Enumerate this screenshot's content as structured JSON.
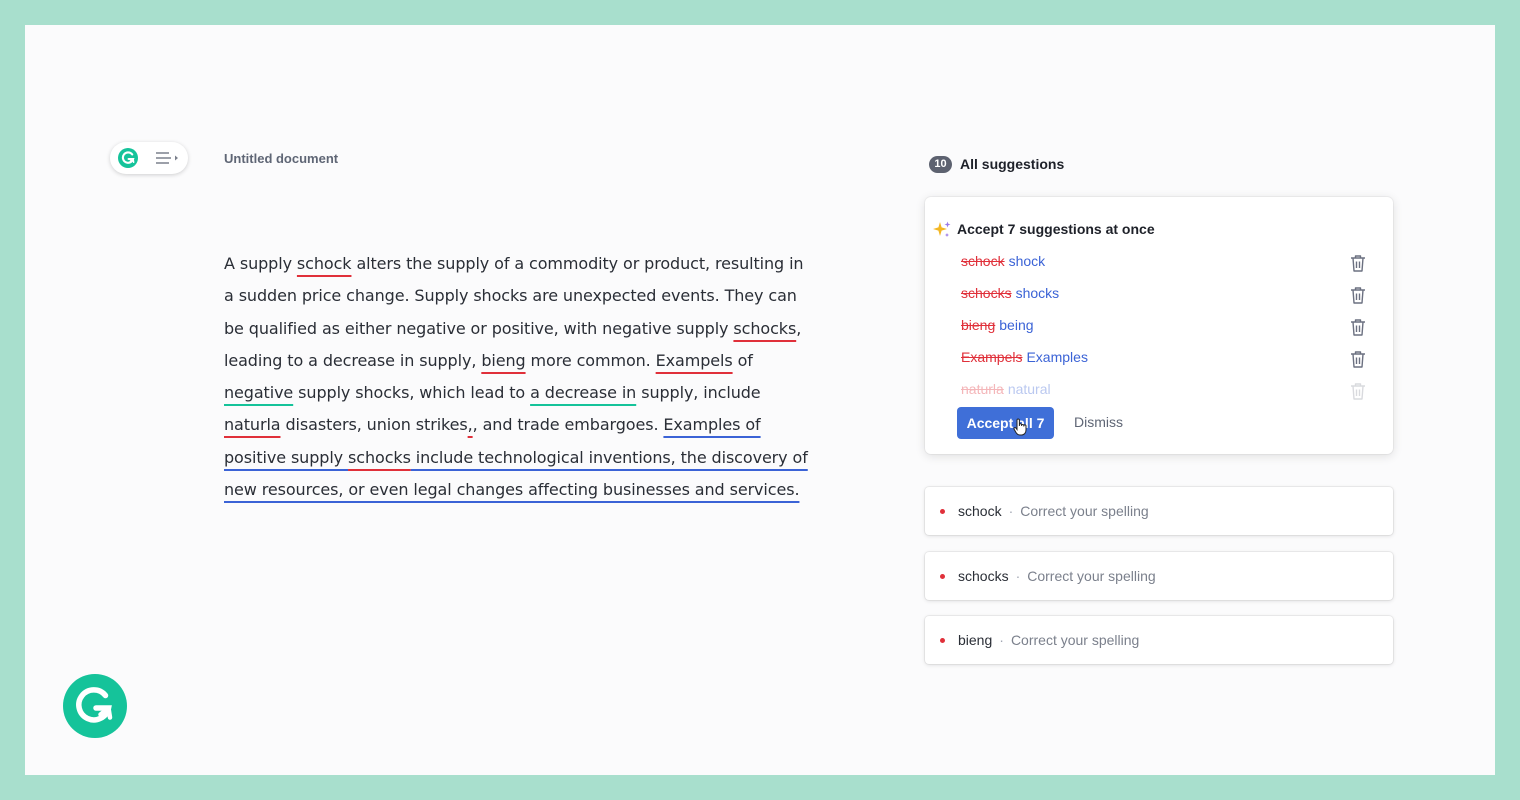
{
  "document": {
    "title": "Untitled document",
    "lines": [
      [
        "A supply ",
        {
          "t": "schock",
          "u": "red"
        },
        " alters the supply of a commodity or product, resulting in"
      ],
      [
        "a sudden price change. Supply shocks are unexpected events. They can"
      ],
      [
        "be qualified as either negative or positive, with negative supply ",
        {
          "t": "schocks",
          "u": "red"
        },
        ","
      ],
      [
        "leading to a decrease in supply, ",
        {
          "t": "bieng",
          "u": "red"
        },
        " more common. ",
        {
          "t": "Exampels",
          "u": "red"
        },
        " of"
      ],
      [
        {
          "t": "negative",
          "u": "green"
        },
        " supply shocks, which lead to ",
        {
          "t": "a decrease in",
          "u": "green"
        },
        " supply, include"
      ],
      [
        {
          "t": "naturla",
          "u": "red"
        },
        " disasters, union strikes",
        {
          "t": ",",
          "u": "red"
        },
        ", and trade embargoes. ",
        {
          "t": "Examples of ",
          "u": "blue"
        }
      ],
      [
        {
          "t": "positive supply ",
          "u": "blue"
        },
        {
          "t": "schocks",
          "u": "red"
        },
        {
          "t": " include technological inventions, the discovery of",
          "u": "blue"
        }
      ],
      [
        {
          "t": "new resources, or even legal changes affecting businesses and services.",
          "u": "blue"
        }
      ]
    ]
  },
  "panel": {
    "count": "10",
    "heading": "All suggestions",
    "card": {
      "title": "Accept 7 suggestions at once",
      "rows": [
        {
          "old": "schock",
          "new": "shock"
        },
        {
          "old": "schocks",
          "new": "shocks"
        },
        {
          "old": "bieng",
          "new": "being"
        },
        {
          "old": "Exampels",
          "new": "Examples"
        },
        {
          "old": "naturla",
          "new": "natural"
        }
      ],
      "accept_label": "Accept all 7",
      "dismiss_label": "Dismiss"
    },
    "issues": [
      {
        "word": "schock",
        "separator": "·",
        "hint": "Correct your spelling"
      },
      {
        "word": "schocks",
        "separator": "·",
        "hint": "Correct your spelling"
      },
      {
        "word": "bieng",
        "separator": "·",
        "hint": "Correct your spelling"
      }
    ]
  },
  "colors": {
    "brand": "#15c39a",
    "error": "#e0303a",
    "correction": "#3b63d6",
    "primary_button": "#3f6fd8",
    "frame": "#a8dfcd"
  },
  "icons": {
    "brand": "grammarly-logo-icon",
    "menu": "menu-lines-icon",
    "sparkle": "sparkle-icon",
    "trash": "trash-icon",
    "cursor": "hand-pointer-icon"
  }
}
